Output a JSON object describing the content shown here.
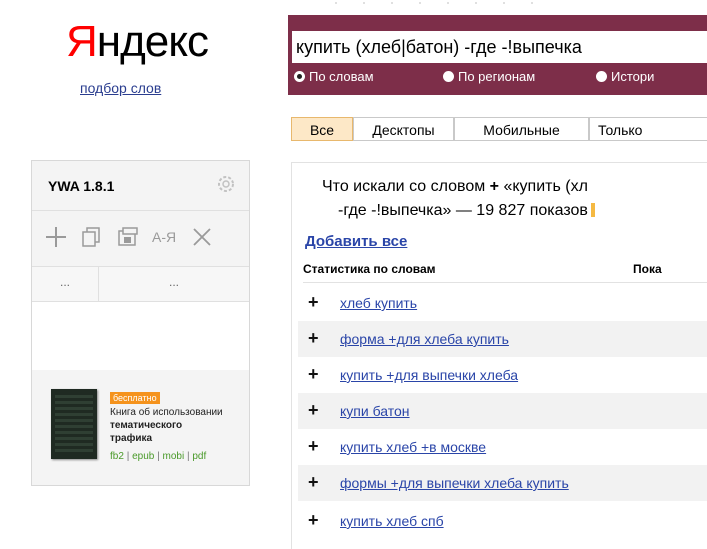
{
  "logo": {
    "first_letter": "Я",
    "rest": "ндекс"
  },
  "podbor_link": "подбор слов",
  "ywa": {
    "title": "YWA 1.8.1",
    "col1": "...",
    "col2": "...",
    "promo": {
      "badge": "бесплатно",
      "line1": "Книга об использовании",
      "line2": "тематического",
      "line3": "трафика",
      "formats": [
        "fb2",
        "epub",
        "mobi",
        "pdf"
      ],
      "separator": "|"
    }
  },
  "search": {
    "query": "купить (хлеб|батон) -где -!выпечка",
    "radios": [
      {
        "label": "По словам",
        "selected": true
      },
      {
        "label": "По регионам",
        "selected": false
      },
      {
        "label": "Истори",
        "selected": false
      }
    ]
  },
  "tabs": [
    {
      "label": "Все",
      "active": true
    },
    {
      "label": "Десктопы",
      "active": false
    },
    {
      "label": "Мобильные",
      "active": false
    },
    {
      "label": "Только",
      "active": false
    }
  ],
  "results": {
    "header_line1_prefix": "Что искали со словом",
    "header_plus": "+",
    "header_line1_suffix": "«купить (хл",
    "header_line2": "-где -!выпечка» — 19 827 показов",
    "add_all": "Добавить все",
    "stat_label": "Статистика по словам",
    "stat_right": "Пока",
    "plus_sign": "+",
    "keywords": [
      "хлеб купить",
      "форма +для хлеба купить",
      "купить +для выпечки хлеба",
      "купи батон",
      "купить хлеб +в москве",
      "формы +для выпечки хлеба купить",
      "купить хлеб спб"
    ]
  },
  "colors": {
    "search_bg": "#7d2e49",
    "link": "#2a45a8",
    "active_tab": "#fde8c7",
    "logo_red": "#ff0000",
    "badge": "#f5931d",
    "formats": "#4a9a2a"
  }
}
